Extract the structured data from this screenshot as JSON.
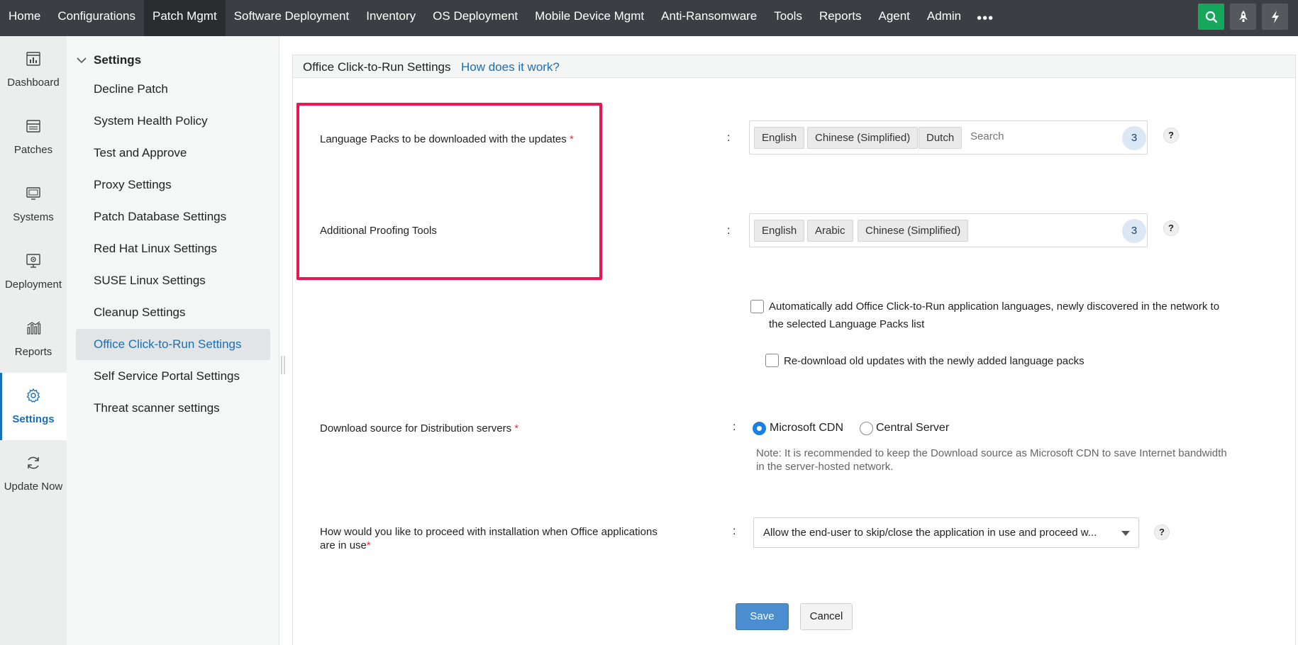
{
  "topnav": {
    "items": [
      "Home",
      "Configurations",
      "Patch Mgmt",
      "Software Deployment",
      "Inventory",
      "OS Deployment",
      "Mobile Device Mgmt",
      "Anti-Ransomware",
      "Tools",
      "Reports",
      "Agent",
      "Admin"
    ],
    "active": "Patch Mgmt",
    "more": "•••",
    "icons": [
      "search-icon",
      "rocket-icon",
      "lightning-icon"
    ],
    "accent": "#16a85a"
  },
  "rail": {
    "items": [
      "Dashboard",
      "Patches",
      "Systems",
      "Deployment",
      "Reports",
      "Settings",
      "Update Now"
    ],
    "active": "Settings"
  },
  "submenu": {
    "heading": "Settings",
    "items": [
      "Decline Patch",
      "System Health Policy",
      "Test and Approve",
      "Proxy Settings",
      "Patch Database Settings",
      "Red Hat Linux Settings",
      "SUSE Linux Settings",
      "Cleanup Settings",
      "Office Click-to-Run Settings",
      "Self Service Portal Settings",
      "Threat scanner settings"
    ],
    "active": "Office Click-to-Run Settings"
  },
  "panel": {
    "title": "Office Click-to-Run Settings",
    "help_link": "How does it work?"
  },
  "form": {
    "colon": ":",
    "required_mark": "*",
    "language_packs": {
      "label": "Language Packs to be downloaded with the updates",
      "chips": [
        "English",
        "Chinese (Simplified)",
        "Dutch"
      ],
      "search_placeholder": "Search",
      "count": "3"
    },
    "proofing": {
      "label": "Additional Proofing Tools",
      "chips": [
        "English",
        "Arabic",
        "Chinese (Simplified)"
      ],
      "count": "3"
    },
    "help": "?",
    "auto_add": {
      "line1": "Automatically add Office Click-to-Run application languages, newly discovered in the network to",
      "line2": "the selected Language Packs list",
      "checked": false
    },
    "redownload": {
      "label": "Re-download old updates with the newly added language packs",
      "checked": false
    },
    "download_source": {
      "label": "Download source for Distribution servers",
      "options": [
        "Microsoft CDN",
        "Central Server"
      ],
      "selected": "Microsoft CDN",
      "note_line1": "Note: It is recommended to keep the Download source as Microsoft CDN to save Internet bandwidth",
      "note_line2": "in the server-hosted network."
    },
    "installation": {
      "label_line1": "How would you like to proceed with installation when Office applications",
      "label_line2": "are in use",
      "value": "Allow the end-user to skip/close the application in use and proceed w..."
    },
    "save": "Save",
    "cancel": "Cancel"
  },
  "highlight_color": "#e8184e"
}
